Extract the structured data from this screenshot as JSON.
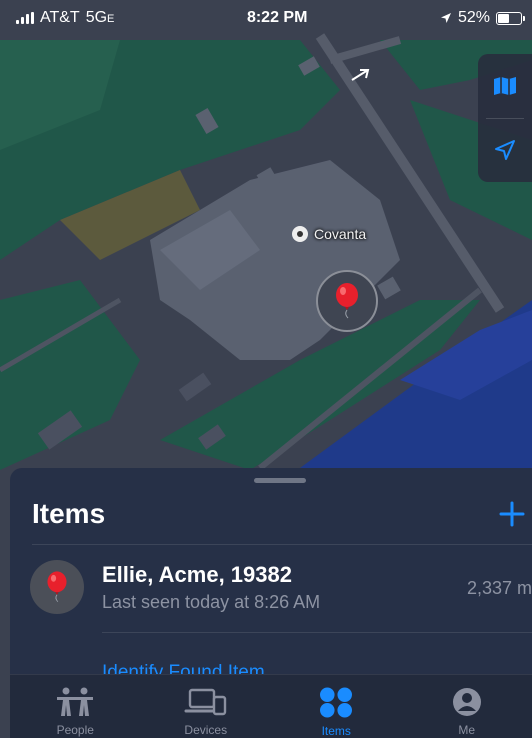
{
  "status_bar": {
    "carrier": "AT&T",
    "network": "5G",
    "network_suffix": "E",
    "time": "8:22 PM",
    "battery": "52%",
    "battery_level": 0.52
  },
  "map": {
    "poi_label": "Covanta"
  },
  "sheet": {
    "title": "Items",
    "items": [
      {
        "name": "Ellie, Acme, 19382",
        "last_seen": "Last seen today at 8:26 AM",
        "distance": "2,337 m"
      }
    ],
    "identify_link": "Identify Found Item"
  },
  "tabs": [
    {
      "label": "People",
      "icon": "people-icon",
      "active": false
    },
    {
      "label": "Devices",
      "icon": "devices-icon",
      "active": false
    },
    {
      "label": "Items",
      "icon": "items-icon",
      "active": true
    },
    {
      "label": "Me",
      "icon": "me-icon",
      "active": false
    }
  ],
  "colors": {
    "accent": "#1a8cff",
    "water": "#1f3a8a",
    "park": "#1f5a4a",
    "building": "#5a6170"
  }
}
